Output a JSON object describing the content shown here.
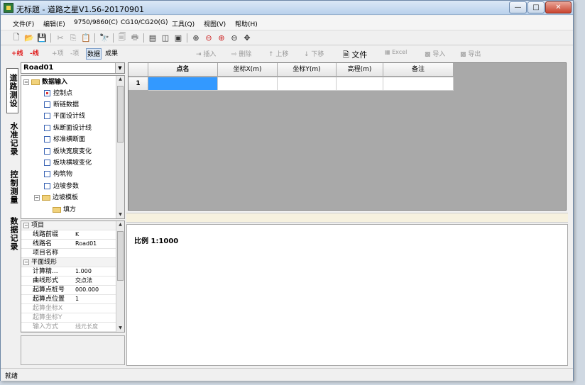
{
  "window": {
    "title": "无标题 - 道路之星V1.56-20170901"
  },
  "menu": [
    "文件(F)",
    "编辑(E)",
    "9750/9860(C)",
    "CG10/CG20(G)",
    "工具(Q)",
    "视图(V)",
    "帮助(H)"
  ],
  "left_tabs": {
    "add_line": "+线",
    "remove_line": "-线",
    "add_item": "+项",
    "remove_item": "-项",
    "data": "数据",
    "result": "成果"
  },
  "vertical_tabs": [
    "道路测设",
    "水准记录",
    "控制测量",
    "数据记录"
  ],
  "road_select": {
    "value": "Road01"
  },
  "tree": {
    "root": "数据输入",
    "items": [
      "控制点",
      "断链数据",
      "平面设计线",
      "纵断面设计线",
      "标准横断面",
      "板块宽度变化",
      "板块横坡变化",
      "构筑物",
      "边坡参数"
    ],
    "folder": "边坡模板",
    "sub": "填方"
  },
  "properties": {
    "cat_project": "项目",
    "rows_project": [
      {
        "k": "线路前缀",
        "v": "K"
      },
      {
        "k": "线路名",
        "v": "Road01"
      },
      {
        "k": "项目名称",
        "v": ""
      }
    ],
    "cat_plane": "平面线形",
    "rows_plane": [
      {
        "k": "计算精...",
        "v": "1.000"
      },
      {
        "k": "曲线形式",
        "v": "交点法"
      },
      {
        "k": "起算点桩号",
        "v": "000.000"
      },
      {
        "k": "起算点位置",
        "v": "1"
      },
      {
        "k": "起算坐标X",
        "v": ""
      },
      {
        "k": "起算坐标Y",
        "v": ""
      },
      {
        "k": "输入方式",
        "v": "线元长度"
      }
    ]
  },
  "right_toolbar": {
    "insert": "插入",
    "delete": "删除",
    "move_up": "上移",
    "move_down": "下移",
    "file": "文件",
    "excel": "Excel",
    "import": "导入",
    "export": "导出"
  },
  "grid": {
    "columns": [
      "点名",
      "坐标X(m)",
      "坐标Y(m)",
      "高程(m)",
      "备注"
    ],
    "rows": [
      {
        "index": "1",
        "cells": [
          "",
          "",
          "",
          "",
          ""
        ]
      }
    ]
  },
  "canvas": {
    "scale": "比例 1:1000"
  },
  "status": {
    "text": "就绪"
  },
  "colors": {
    "accent": "#3399ff",
    "add": "#e02020",
    "grid_bg": "#a9a9a9"
  }
}
